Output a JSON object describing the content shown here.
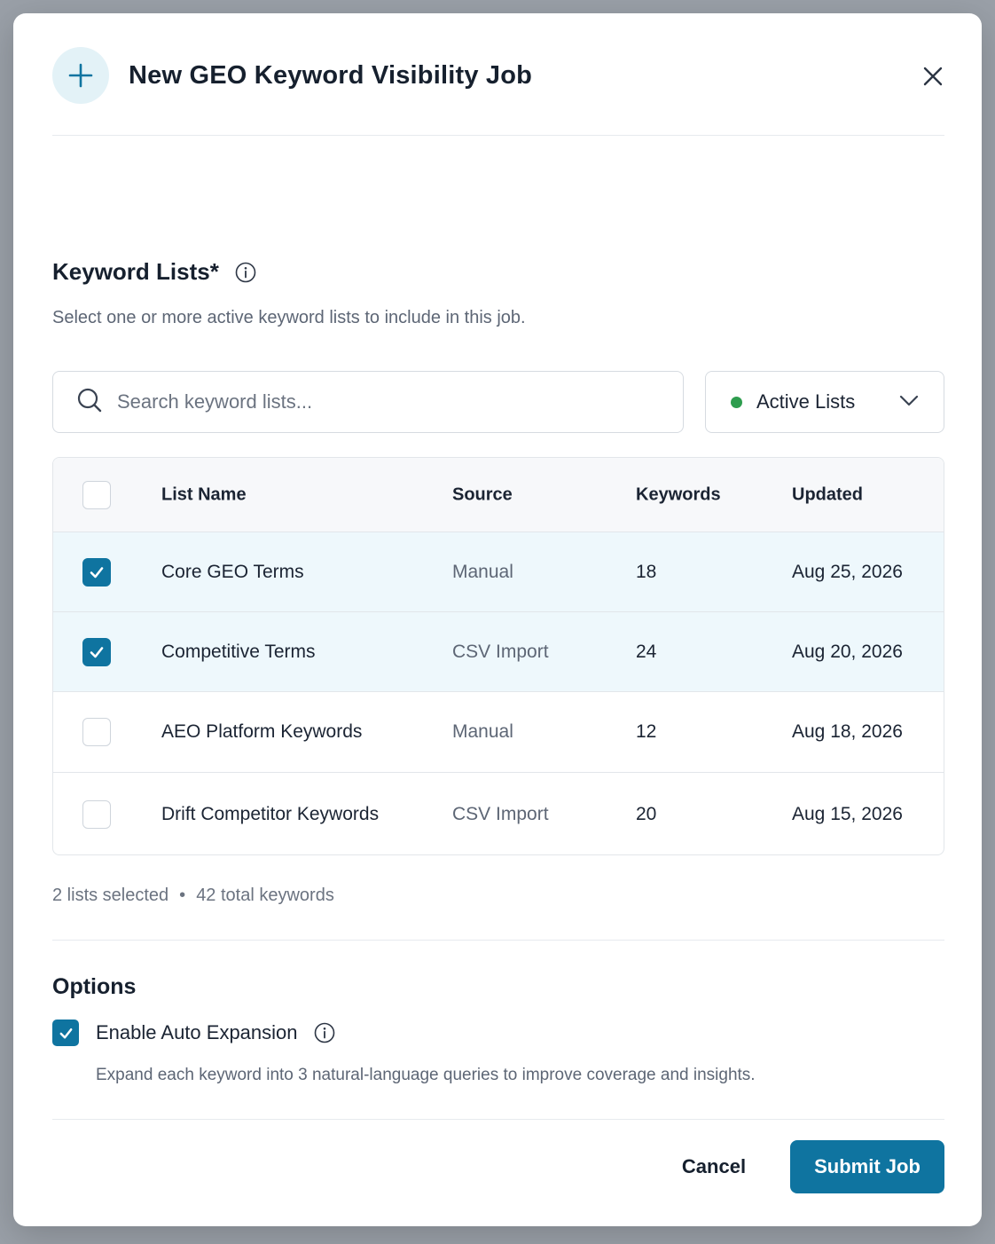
{
  "dialog": {
    "title": "New GEO Keyword Visibility Job",
    "icons": {
      "header": "plus-icon",
      "close": "close-icon"
    }
  },
  "keyword_lists": {
    "title": "Keyword Lists*",
    "description": "Select one or more active keyword lists to include in this job.",
    "search_placeholder": "Search keyword lists...",
    "search_value": "",
    "filter": {
      "label": "Active Lists",
      "status_color": "#2e9d4e"
    },
    "columns": [
      "List Name",
      "Source",
      "Keywords",
      "Updated"
    ],
    "rows": [
      {
        "name": "Core GEO Terms",
        "source": "Manual",
        "keywords": "18",
        "updated": "Aug 25, 2026",
        "checked": true
      },
      {
        "name": "Competitive Terms",
        "source": "CSV Import",
        "keywords": "24",
        "updated": "Aug 20, 2026",
        "checked": true
      },
      {
        "name": "AEO Platform Keywords",
        "source": "Manual",
        "keywords": "12",
        "updated": "Aug 18, 2026",
        "checked": false
      },
      {
        "name": "Drift Competitor Keywords",
        "source": "CSV Import",
        "keywords": "20",
        "updated": "Aug 15, 2026",
        "checked": false
      }
    ],
    "summary": {
      "selected": "2 lists selected",
      "separator": "•",
      "total": "42 total keywords"
    }
  },
  "options": {
    "title": "Options",
    "auto_expansion": {
      "label": "Enable Auto Expansion",
      "checked": true,
      "description": "Expand each keyword into 3 natural-language queries to improve coverage and insights."
    }
  },
  "footer": {
    "cancel": "Cancel",
    "submit": "Submit Job"
  },
  "colors": {
    "accent": "#0f74a0",
    "selected_row": "#eef8fc",
    "header_icon_bg": "#e3f2f7"
  }
}
